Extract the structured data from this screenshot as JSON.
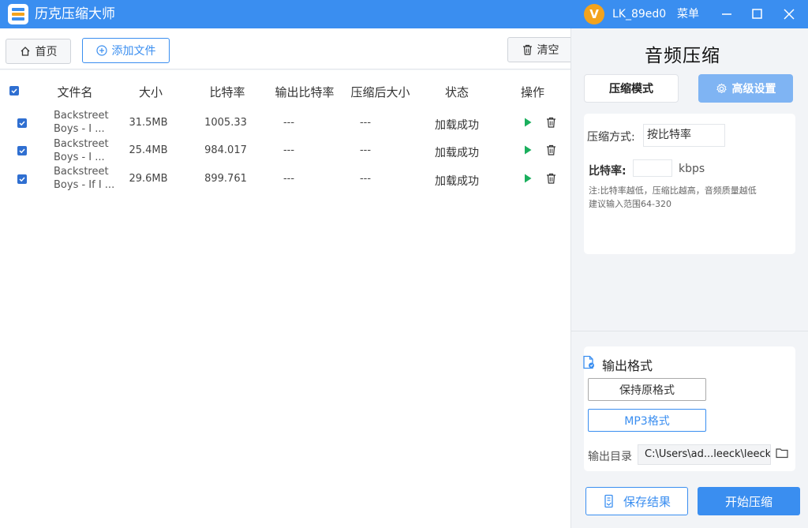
{
  "app": {
    "title": "历克压缩大师",
    "colors": {
      "accent": "#3a8ef0",
      "accent_light": "#7fb4f3",
      "play": "#1aaf5d",
      "avatar": "#f3a31d"
    }
  },
  "user": {
    "avatar_letter": "V",
    "name": "LK_89ed0"
  },
  "menu": {
    "label": "菜单"
  },
  "toolbar": {
    "home_label": "首页",
    "add_label": "添加文件",
    "clear_label": "清空"
  },
  "table": {
    "headers": [
      "文件名",
      "大小",
      "比特率",
      "输出比特率",
      "压缩后大小",
      "状态",
      "操作"
    ],
    "rows": [
      {
        "name_line1": "Backstreet",
        "name_line2": "Boys - I ...",
        "size": "31.5MB",
        "bitrate": "1005.33",
        "out_bitrate": "---",
        "out_size": "---",
        "status": "加载成功"
      },
      {
        "name_line1": "Backstreet",
        "name_line2": "Boys - I ...",
        "size": "25.4MB",
        "bitrate": "984.017",
        "out_bitrate": "---",
        "out_size": "---",
        "status": "加载成功"
      },
      {
        "name_line1": "Backstreet",
        "name_line2": "Boys - If I ...",
        "size": "29.6MB",
        "bitrate": "899.761",
        "out_bitrate": "---",
        "out_size": "---",
        "status": "加载成功"
      }
    ]
  },
  "panel": {
    "title": "音频压缩",
    "tab_mode": "压缩模式",
    "tab_advanced": "高级设置",
    "method_label": "压缩方式:",
    "method_value": "按比特率",
    "bitrate_label": "比特率:",
    "bitrate_value": "",
    "bitrate_unit": "kbps",
    "note_line1": "注:比特率越低，压缩比越高，音频质量越低",
    "note_line2": "建议输入范围64-320",
    "output_title": "输出格式",
    "format_keep": "保持原格式",
    "format_mp3": "MP3格式",
    "dir_label": "输出目录",
    "dir_value": "C:\\Users\\ad...leeck\\leeck",
    "save_label": "保存结果",
    "start_label": "开始压缩"
  }
}
